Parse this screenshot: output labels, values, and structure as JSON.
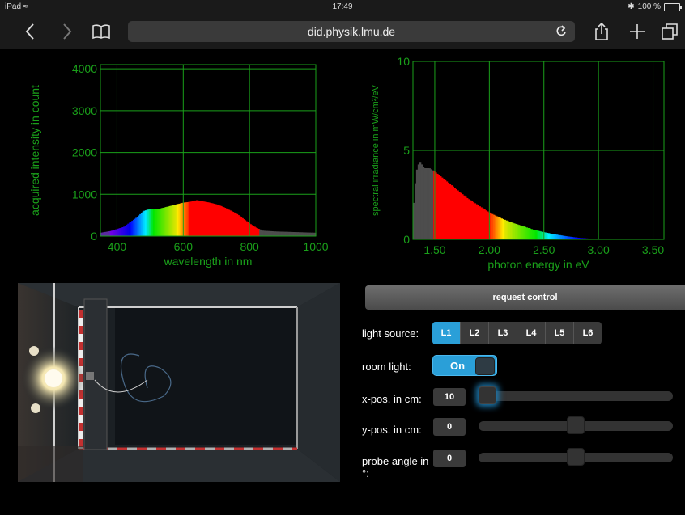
{
  "status_bar": {
    "device": "iPad",
    "time": "17:49",
    "battery": "100 %",
    "battery_level": 1.0
  },
  "browser": {
    "url": "did.physik.lmu.de",
    "icons": [
      "back-icon",
      "forward-icon",
      "bookmarks-icon",
      "reload-icon",
      "share-icon",
      "new-tab-icon",
      "tabs-icon"
    ]
  },
  "chart_data": [
    {
      "type": "area",
      "xlabel": "wavelength in nm",
      "ylabel": "acquired intensity in count",
      "xlim": [
        350,
        1000
      ],
      "ylim": [
        0,
        4100
      ],
      "xticks": [
        400,
        600,
        800,
        1000
      ],
      "yticks": [
        0,
        1000,
        2000,
        3000,
        4000
      ],
      "grid": true,
      "x": [
        350,
        380,
        420,
        460,
        480,
        500,
        520,
        540,
        560,
        580,
        600,
        620,
        640,
        660,
        680,
        700,
        720,
        740,
        760,
        780,
        800,
        820,
        840,
        880,
        920,
        960,
        1000
      ],
      "y": [
        80,
        120,
        220,
        450,
        600,
        650,
        640,
        680,
        720,
        760,
        800,
        820,
        860,
        830,
        800,
        760,
        700,
        620,
        540,
        420,
        300,
        200,
        130,
        110,
        100,
        90,
        80
      ]
    },
    {
      "type": "area",
      "xlabel": "photon energy in eV",
      "ylabel": "spectral irradiance in mW/cm²/eV",
      "xlim": [
        1.3,
        3.6
      ],
      "ylim": [
        0,
        10
      ],
      "xticks": [
        1.5,
        2.0,
        2.5,
        3.0,
        3.5
      ],
      "xtick_labels": [
        "1.50",
        "2.00",
        "2.50",
        "3.00",
        "3.50"
      ],
      "yticks": [
        0,
        5,
        10
      ],
      "grid": true,
      "x": [
        1.3,
        1.33,
        1.36,
        1.4,
        1.45,
        1.5,
        1.6,
        1.7,
        1.8,
        1.9,
        2.0,
        2.1,
        2.2,
        2.3,
        2.4,
        2.5,
        2.6,
        2.7,
        2.8,
        2.9,
        3.0,
        3.1,
        3.2
      ],
      "y": [
        1.5,
        3.8,
        4.4,
        4.0,
        4.0,
        3.8,
        3.3,
        2.8,
        2.3,
        1.9,
        1.5,
        1.2,
        0.95,
        0.75,
        0.55,
        0.4,
        0.28,
        0.18,
        0.1,
        0.05,
        0.02,
        0.01,
        0
      ]
    }
  ],
  "controls": {
    "request_label": "request control",
    "light_source_label": "light source:",
    "light_sources": [
      "L1",
      "L2",
      "L3",
      "L4",
      "L5",
      "L6"
    ],
    "light_source_selected": "L1",
    "room_light_label": "room light:",
    "room_light_value": "On",
    "x_label": "x-pos. in cm:",
    "x_value": "10",
    "x_fraction": 0.0,
    "y_label": "y-pos. in cm:",
    "y_value": "0",
    "y_fraction": 0.5,
    "angle_label": "probe angle in °:",
    "angle_value": "0",
    "angle_fraction": 0.5
  },
  "colors": {
    "grid_green": "#1aa01a",
    "accent_blue": "#2a9fd8"
  }
}
